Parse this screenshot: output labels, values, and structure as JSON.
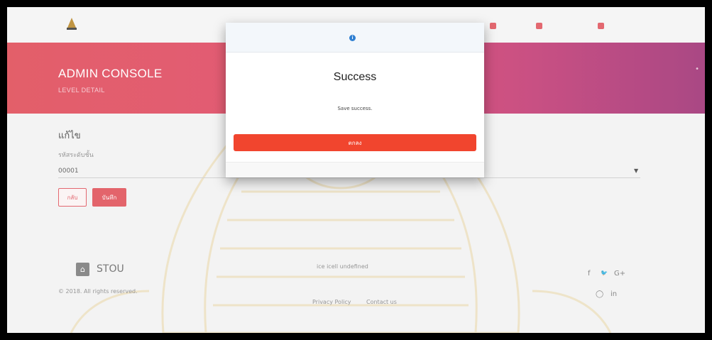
{
  "header": {
    "title": "ADMIN CONSOLE",
    "subtitle": "LEVEL DETAIL"
  },
  "form": {
    "title": "แก้ไข",
    "field_label": "รหัสระดับชั้น",
    "field_value": "00001",
    "back_label": "กลับ",
    "save_label": "บันทึก"
  },
  "footer": {
    "brand": "STOU",
    "copyright": "© 2018. All rights reserved.",
    "middle_text": "ice icell undefined",
    "privacy": "Privacy Policy",
    "contact": "Contact us",
    "social": [
      "f",
      "🐦",
      "G+",
      "◯",
      "in"
    ]
  },
  "modal": {
    "title": "Success",
    "message": "Save success.",
    "ok_label": "ตกลง",
    "icon": "info-icon"
  },
  "colors": {
    "header_start": "#e04955",
    "header_end": "#9e2f73",
    "modal_button": "#f1452e",
    "info": "#2f7fd1"
  }
}
